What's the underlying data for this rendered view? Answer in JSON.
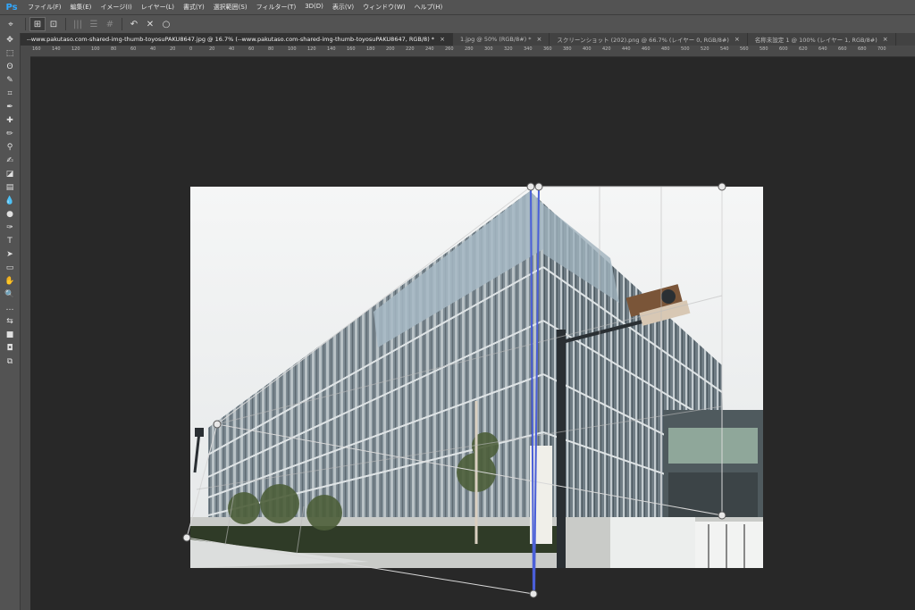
{
  "app": {
    "logo": "Ps"
  },
  "menu": [
    "ファイル(F)",
    "編集(E)",
    "イメージ(I)",
    "レイヤー(L)",
    "書式(Y)",
    "選択範囲(S)",
    "フィルター(T)",
    "3D(D)",
    "表示(V)",
    "ウィンドウ(W)",
    "ヘルプ(H)"
  ],
  "options_bar": {
    "tool_icon": "perspective-crop-icon",
    "buttons": [
      {
        "name": "layout-mode-icon",
        "glyph": "⊞",
        "active": true
      },
      {
        "name": "warp-mode-icon",
        "glyph": "⊡",
        "active": false
      },
      {
        "name": "vertical-straighten-icon",
        "glyph": "|||",
        "dim": true
      },
      {
        "name": "horizontal-straighten-icon",
        "glyph": "☰",
        "dim": true
      },
      {
        "name": "both-straighten-icon",
        "glyph": "#",
        "dim": true
      },
      {
        "name": "undo-perspective-icon",
        "glyph": "↶"
      },
      {
        "name": "cancel-icon",
        "glyph": "✕"
      },
      {
        "name": "commit-icon",
        "glyph": "○"
      }
    ]
  },
  "tabs": [
    {
      "label": "--www.pakutaso.com-shared-img-thumb-toyosuPAKU8647.jpg @ 16.7% (--www.pakutaso.com-shared-img-thumb-toyosuPAKU8647, RGB/8) *",
      "active": true
    },
    {
      "label": "1.jpg @ 50% (RGB/8#) *",
      "active": false
    },
    {
      "label": "スクリーンショット (202).png @ 66.7% (レイヤー 0, RGB/8#)",
      "active": false
    },
    {
      "label": "名称未設定 1 @ 100% (レイヤー 1, RGB/8#)",
      "active": false
    }
  ],
  "ruler_labels": [
    "160",
    "140",
    "120",
    "100",
    "80",
    "60",
    "40",
    "20",
    "0",
    "20",
    "40",
    "60",
    "80",
    "100",
    "120",
    "140",
    "160",
    "180",
    "200",
    "220",
    "240",
    "260",
    "280",
    "300",
    "320",
    "340",
    "360",
    "380",
    "400",
    "420",
    "440",
    "460",
    "480",
    "500",
    "520",
    "540",
    "560",
    "580",
    "600",
    "620",
    "640",
    "660",
    "680",
    "700"
  ],
  "tools": [
    "move-icon",
    "marquee-icon",
    "lasso-icon",
    "quick-select-icon",
    "crop-icon",
    "eyedropper-icon",
    "healing-icon",
    "brush-icon",
    "stamp-icon",
    "history-brush-icon",
    "eraser-icon",
    "gradient-icon",
    "blur-icon",
    "dodge-icon",
    "pen-icon",
    "type-icon",
    "path-select-icon",
    "rectangle-icon",
    "hand-icon",
    "zoom-icon",
    "more-icon",
    "default-colors-icon",
    "color-swatch-icon",
    "quickmask-icon",
    "screen-mode-icon"
  ],
  "tool_glyphs": [
    "✥",
    "⬚",
    "ʘ",
    "✎",
    "⌗",
    "✒",
    "✚",
    "✏",
    "⚲",
    "✍",
    "◪",
    "▤",
    "💧",
    "●",
    "✑",
    "T",
    "➤",
    "▭",
    "✋",
    "🔍",
    "…",
    "⇆",
    "■",
    "◘",
    "⧉"
  ]
}
